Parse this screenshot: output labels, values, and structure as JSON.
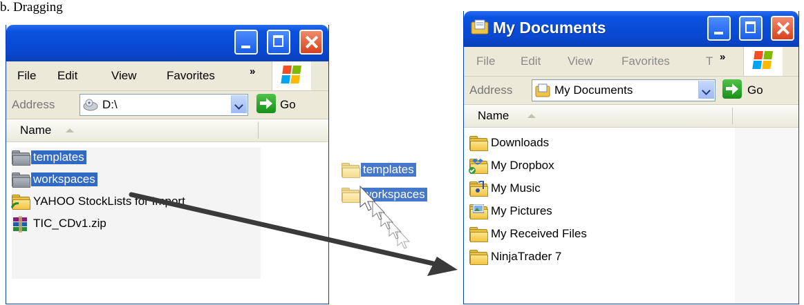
{
  "caption": "b. Dragging",
  "left_window": {
    "menu": [
      "File",
      "Edit",
      "View",
      "Favorites"
    ],
    "chevron": "»",
    "address_label": "Address",
    "address_value": "D:\\",
    "go_label": "Go",
    "column_name": "Name",
    "files": [
      {
        "name": "templates",
        "type": "folder",
        "selected": true
      },
      {
        "name": "workspaces",
        "type": "folder",
        "selected": true
      },
      {
        "name": "YAHOO StockLists for Import",
        "type": "shared-folder",
        "selected": false
      },
      {
        "name": "TIC_CDv1.zip",
        "type": "zip",
        "selected": false
      }
    ]
  },
  "drag_ghost": {
    "items": [
      "templates",
      "workspaces"
    ]
  },
  "right_window": {
    "title": "My Documents",
    "menu": [
      "File",
      "Edit",
      "View",
      "Favorites",
      "T"
    ],
    "chevron": "»",
    "address_label": "Address",
    "address_value": "My Documents",
    "go_label": "Go",
    "column_name": "Name",
    "files": [
      {
        "name": "Downloads",
        "type": "folder"
      },
      {
        "name": "My Dropbox",
        "type": "dropbox-folder"
      },
      {
        "name": "My Music",
        "type": "music-folder"
      },
      {
        "name": "My Pictures",
        "type": "pictures-folder"
      },
      {
        "name": "My Received Files",
        "type": "folder"
      },
      {
        "name": "NinjaTrader 7",
        "type": "folder"
      }
    ]
  }
}
